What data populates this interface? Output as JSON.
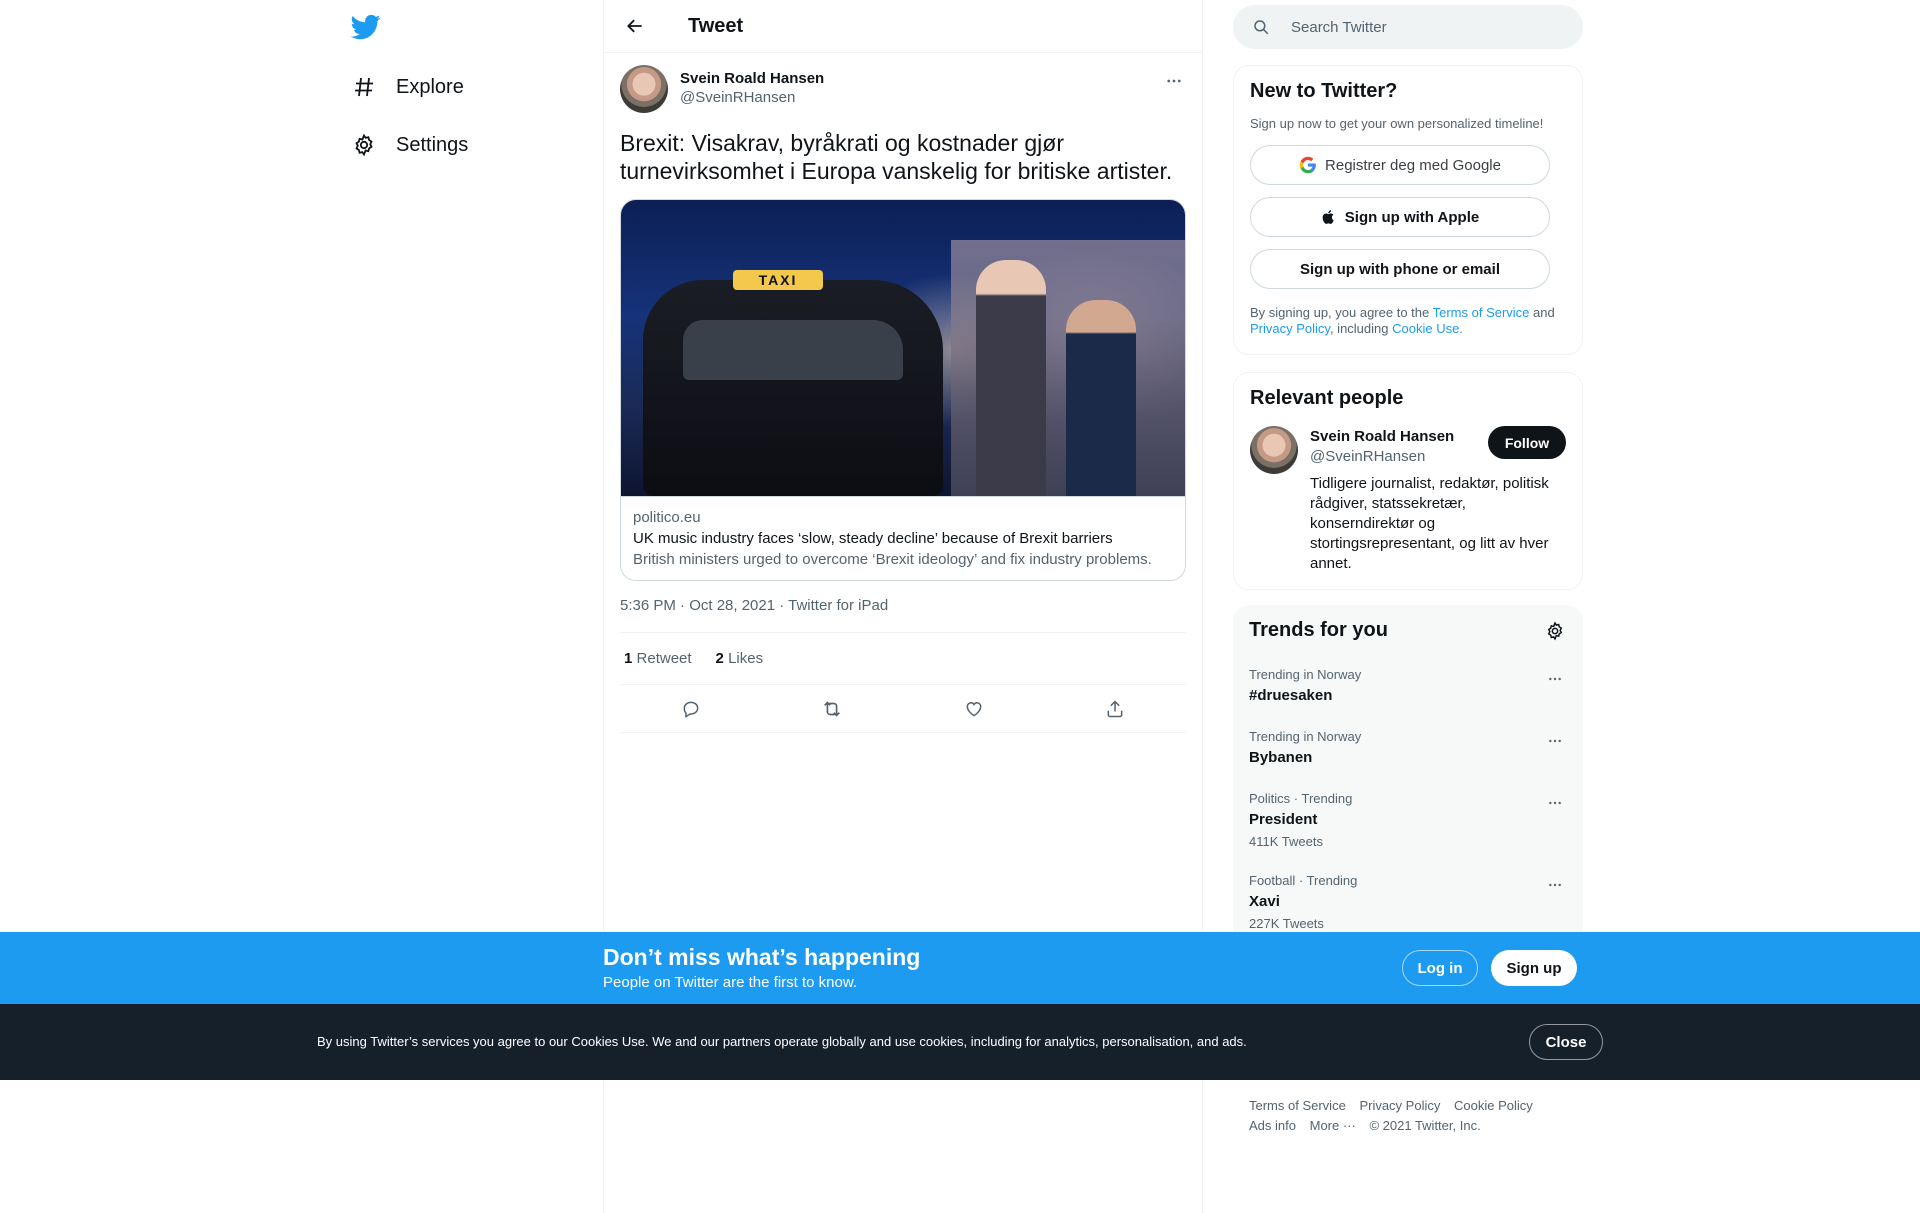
{
  "nav": {
    "items": [
      {
        "label": "Explore",
        "icon": "hashtag-icon"
      },
      {
        "label": "Settings",
        "icon": "gear-icon"
      }
    ]
  },
  "header": {
    "title": "Tweet"
  },
  "tweet": {
    "author_name": "Svein Roald Hansen",
    "author_handle": "@SveinRHansen",
    "text": "Brexit: Visakrav, byråkrati og kostnader gjør turnevirksomhet i Europa vanskelig for britiske artister.",
    "card": {
      "image_sign": "TAXI",
      "domain": "politico.eu",
      "title": "UK music industry faces ‘slow, steady decline’ because of Brexit barriers",
      "description": "British ministers urged to overcome ‘Brexit ideology’ and fix industry problems."
    },
    "timestamp": "5:36 PM · Oct 28, 2021 · Twitter for iPad",
    "retweets_count": "1",
    "retweets_label": "Retweet",
    "likes_count": "2",
    "likes_label": "Likes"
  },
  "search": {
    "placeholder": "Search Twitter"
  },
  "signup": {
    "title": "New to Twitter?",
    "subtitle": "Sign up now to get your own personalized timeline!",
    "google": "Registrer deg med Google",
    "apple": "Sign up with Apple",
    "phone": "Sign up with phone or email",
    "legal_prefix": "By signing up, you agree to the ",
    "tos": "Terms of Service",
    "and": " and ",
    "privacy": "Privacy Policy",
    "including": ", including ",
    "cookie": "Cookie Use."
  },
  "relevant": {
    "title": "Relevant people",
    "name": "Svein Roald Hansen",
    "handle": "@SveinRHansen",
    "follow": "Follow",
    "bio": "Tidligere journalist, redaktør, politisk rådgiver, statssekretær, konserndirektør og stortingsrepresentant, og litt av hver annet."
  },
  "trends": {
    "title": "Trends for you",
    "items": [
      {
        "context": "Trending in Norway",
        "name": "#druesaken",
        "count": ""
      },
      {
        "context": "Trending in Norway",
        "name": "Bybanen",
        "count": ""
      },
      {
        "context": "Politics · Trending",
        "name": "President",
        "count": "411K Tweets"
      },
      {
        "context": "Football · Trending",
        "name": "Xavi",
        "count": "227K Tweets"
      }
    ]
  },
  "footer": {
    "tos": "Terms of Service",
    "privacy": "Privacy Policy",
    "cookie": "Cookie Policy",
    "ads": "Ads info",
    "more": "More ···",
    "copyright": "© 2021 Twitter, Inc."
  },
  "banner": {
    "title": "Don’t miss what’s happening",
    "subtitle": "People on Twitter are the first to know.",
    "login": "Log in",
    "signup": "Sign up"
  },
  "cookie_bar": {
    "text": "By using Twitter’s services you agree to our Cookies Use. We and our partners operate globally and use cookies, including for analytics, personalisation, and ads.",
    "close": "Close"
  },
  "colors": {
    "accent": "#1d9bf0",
    "text": "#0f1419",
    "muted": "#536471",
    "dark_bar": "#15202b"
  }
}
